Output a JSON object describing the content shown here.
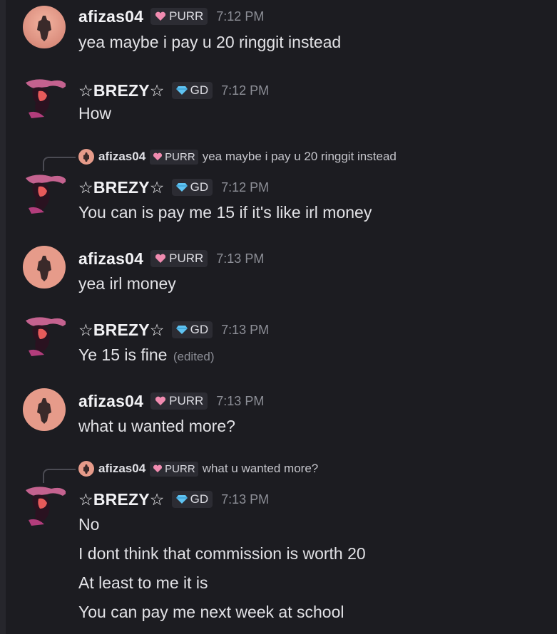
{
  "users": {
    "afizas": {
      "name": "afizas04",
      "tag": "PURR"
    },
    "brezy": {
      "name": "☆BREZY☆",
      "tag": "GD"
    }
  },
  "messages": [
    {
      "ts": "7:12 PM",
      "text": "yea maybe i pay u 20 ringgit instead"
    },
    {
      "ts": "7:12 PM",
      "text": "How"
    },
    {
      "reply_text": "yea maybe i pay u 20 ringgit instead",
      "ts": "7:12 PM",
      "text": "You can is pay me 15 if it's like irl money"
    },
    {
      "ts": "7:13 PM",
      "text": "yea irl money"
    },
    {
      "ts": "7:13 PM",
      "text": "Ye 15 is fine",
      "edited": "(edited)"
    },
    {
      "ts": "7:13 PM",
      "text": "what u wanted more?"
    },
    {
      "reply_text": "what u wanted more?",
      "ts": "7:13 PM",
      "lines": [
        "No",
        "I dont think that commission is worth 20",
        "At least to me it is",
        "You can pay me next week at school"
      ]
    }
  ],
  "colors": {
    "background": "#1c1c21",
    "tag_bg": "#2c2c33",
    "timestamp": "#8d8f97",
    "heart": "#f08bb0",
    "gem": "#5fc3f2"
  },
  "icons": {
    "purr_tag": "heart-icon",
    "gd_tag": "diamond-icon"
  }
}
